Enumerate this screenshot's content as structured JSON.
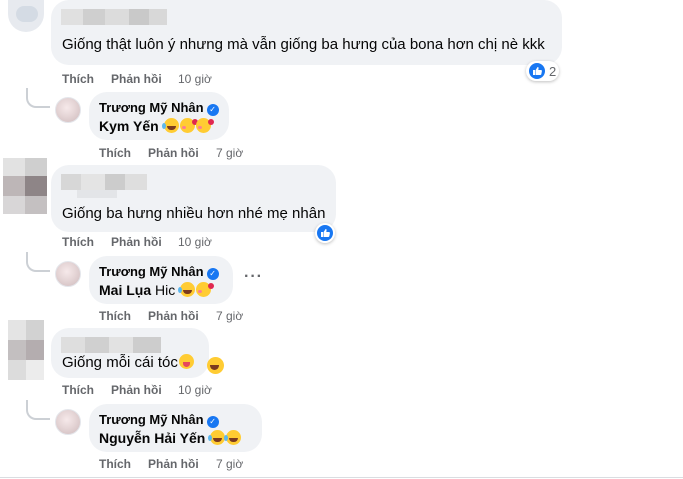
{
  "comments": [
    {
      "text": "Giống thật luôn ý nhưng mà vẫn giống ba hưng của bona hơn chị nè kkk",
      "actions": {
        "like": "Thích",
        "reply": "Phản hồi",
        "time": "10 giờ"
      },
      "reaction_count": "2",
      "reply": {
        "author": "Trương Mỹ Nhân",
        "tagged": "Kym Yến",
        "text": "",
        "emojis": [
          "laugh-icon",
          "love-icon",
          "love-icon"
        ],
        "actions": {
          "like": "Thích",
          "reply": "Phản hồi",
          "time": "7 giờ"
        }
      }
    },
    {
      "text": "Giống ba hưng nhiều hơn nhé mẹ nhân",
      "actions": {
        "like": "Thích",
        "reply": "Phản hồi",
        "time": "10 giờ"
      },
      "reaction_count": "",
      "reply": {
        "author": "Trương Mỹ Nhân",
        "tagged": "Mai Lụa",
        "text": "Hic",
        "emojis": [
          "laugh-icon",
          "love-icon"
        ],
        "actions": {
          "like": "Thích",
          "reply": "Phản hồi",
          "time": "7 giờ"
        }
      }
    },
    {
      "text": "Giống mỗi cái tóc",
      "actions": {
        "like": "Thích",
        "reply": "Phản hồi",
        "time": "10 giờ"
      },
      "reaction_count": "",
      "reply": {
        "author": "Trương Mỹ Nhân",
        "tagged": "Nguyễn Hải Yến",
        "text": "",
        "emojis": [
          "laugh-icon",
          "laugh-icon"
        ],
        "actions": {
          "like": "Thích",
          "reply": "Phản hồi",
          "time": "7 giờ"
        }
      }
    }
  ],
  "colors": {
    "bubble": "#f0f2f5",
    "action_text": "#65676b",
    "verified": "#1877f2",
    "like": "#1877f2"
  }
}
